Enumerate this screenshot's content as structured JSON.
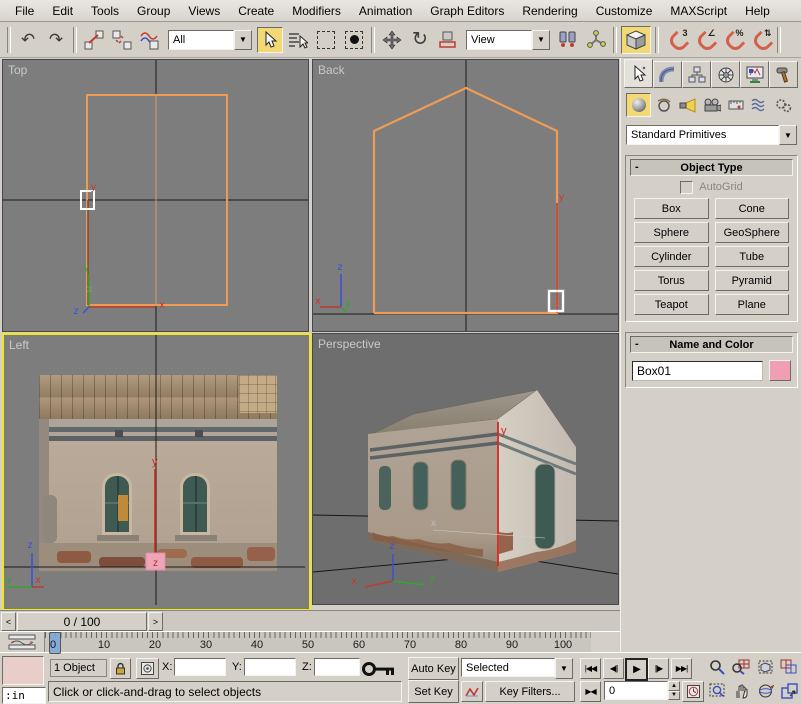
{
  "menu": {
    "items": [
      "File",
      "Edit",
      "Tools",
      "Group",
      "Views",
      "Create",
      "Modifiers",
      "Animation",
      "Graph Editors",
      "Rendering",
      "Customize",
      "MAXScript",
      "Help"
    ]
  },
  "toolbar": {
    "selection_filter_value": "All",
    "coordinate_system_value": "View",
    "dropdown_arrow": "▼",
    "undo_glyph": "↶",
    "redo_glyph": "↷",
    "rotate_glyph": "↻",
    "magnet_3": "3",
    "magnet_angle": "∠",
    "magnet_percent": "%",
    "magnet_spinner": "⇅"
  },
  "viewports": {
    "top": {
      "label": "Top"
    },
    "back": {
      "label": "Back"
    },
    "left": {
      "label": "Left"
    },
    "perspective": {
      "label": "Perspective"
    },
    "axis": {
      "x": "x",
      "y": "y",
      "z": "z"
    },
    "colors": {
      "selection_orange": "#ee9c55",
      "active_border": "#f2e718",
      "gizmo_pink": "#f0a4b8"
    }
  },
  "command_panel": {
    "category_dropdown_value": "Standard Primitives",
    "object_type": {
      "title": "Object Type",
      "collapse": "-",
      "autogrid_label": "AutoGrid",
      "buttons": [
        "Box",
        "Cone",
        "Sphere",
        "GeoSphere",
        "Cylinder",
        "Tube",
        "Torus",
        "Pyramid",
        "Teapot",
        "Plane"
      ]
    },
    "name_color": {
      "title": "Name and Color",
      "collapse": "-",
      "name_value": "Box01",
      "object_color": "#ef9eb4"
    }
  },
  "timeline": {
    "slider_value": "0 / 100",
    "prev_arrow": "<",
    "next_arrow": ">",
    "ticks": [
      "0",
      "10",
      "20",
      "30",
      "40",
      "50",
      "60",
      "70",
      "80",
      "90",
      "100"
    ]
  },
  "status": {
    "macro_recorder_color": "#e9cdc9",
    "listener_text": ":in",
    "selection_count": "1 Object",
    "x_label": "X:",
    "y_label": "Y:",
    "z_label": "Z:",
    "x_value": "",
    "y_value": "",
    "z_value": "",
    "prompt": "Click or click-and-drag to select objects"
  },
  "animation": {
    "auto_key_label": "Auto Key",
    "set_key_label": "Set Key",
    "selection_set_value": "Selected",
    "key_filters_label": "Key Filters...",
    "frame_value": "0",
    "playback": {
      "go_start": "|◀◀",
      "prev_frame": "◀||",
      "play": "▶",
      "next_frame": "||▶",
      "go_end": "▶▶|",
      "key_mode": "▶◀"
    }
  }
}
